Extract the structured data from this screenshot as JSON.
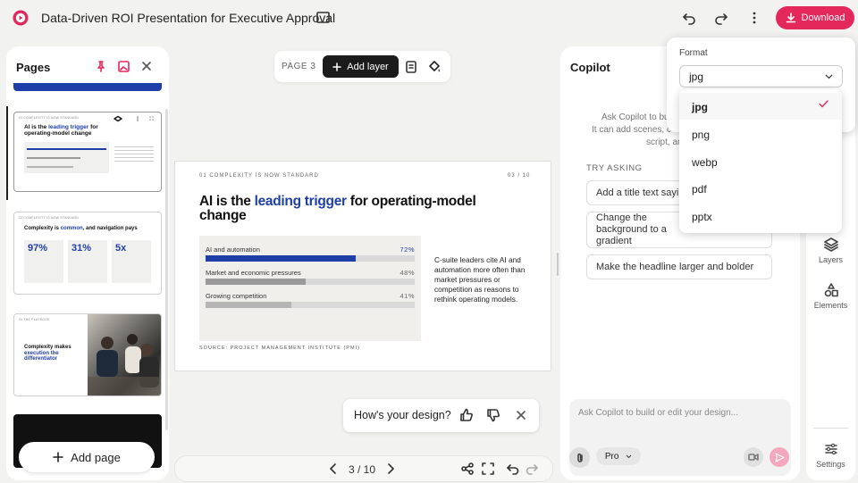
{
  "app": {
    "title": "Data-Driven ROI Presentation for Executive Approval",
    "download_label": "Download",
    "accent": "#e5285b"
  },
  "pages_panel": {
    "title": "Pages",
    "add_page_label": "Add page",
    "thumb1": {
      "header": "01  COMPLEXITY IS NOW STANDARD",
      "title_a": "AI is the",
      "title_b": "leading trigger",
      "title_c": "for operating-model change"
    },
    "thumb2": {
      "header": "02  COMPLEXITY IS NOW STANDARD",
      "title_a": "Complexity is",
      "title_b": "common",
      "title_c": ", and navigation pays",
      "stats": [
        "97%",
        "31%",
        "5x"
      ]
    },
    "thumb3": {
      "header": "03  THE PLAYBOOK",
      "title_a": "Complexity makes",
      "title_b": "execution the differentiator"
    }
  },
  "toolbar": {
    "page_label": "PAGE 3",
    "add_layer_label": "Add layer"
  },
  "slide": {
    "kicker": "01  COMPLEXITY IS NOW STANDARD",
    "page_num": "03 / 10",
    "title_a": "AI is the ",
    "title_b": "leading trigger",
    "title_c": " for operating-model change",
    "bars": [
      {
        "label": "AI and automation",
        "value": 72,
        "value_label": "72%",
        "color": "#1e3ea8"
      },
      {
        "label": "Market and economic pressures",
        "value": 48,
        "value_label": "48%",
        "color": "#9a9a9a"
      },
      {
        "label": "Growing competition",
        "value": 41,
        "value_label": "41%",
        "color": "#b5b5b5"
      }
    ],
    "body": "C-suite leaders cite AI and automation more often than market pressures or competition as reasons to rethink operating models.",
    "source": "SOURCE: PROJECT MANAGEMENT INSTITUTE (PMI)",
    "highlight_color": "#1e3ea8"
  },
  "feedback": {
    "question": "How's your design?"
  },
  "pager": {
    "label": "3 / 10"
  },
  "copilot": {
    "title": "Copilot",
    "intro_1": "Ask Copilot to bui",
    "intro_2": "It can add scenes, c",
    "intro_3": "script, an",
    "try_asking": "TRY ASKING",
    "suggestions": [
      "Add a title text saying",
      "Change the background to a gradient",
      "Make the headline larger and bolder"
    ],
    "input_placeholder": "Ask Copilot to build or edit your design...",
    "mode": "Pro"
  },
  "rail": {
    "layers": "Layers",
    "elements": "Elements",
    "settings": "Settings"
  },
  "format": {
    "label": "Format",
    "selected": "jpg",
    "options": [
      "jpg",
      "png",
      "webp",
      "pdf",
      "pptx"
    ]
  }
}
